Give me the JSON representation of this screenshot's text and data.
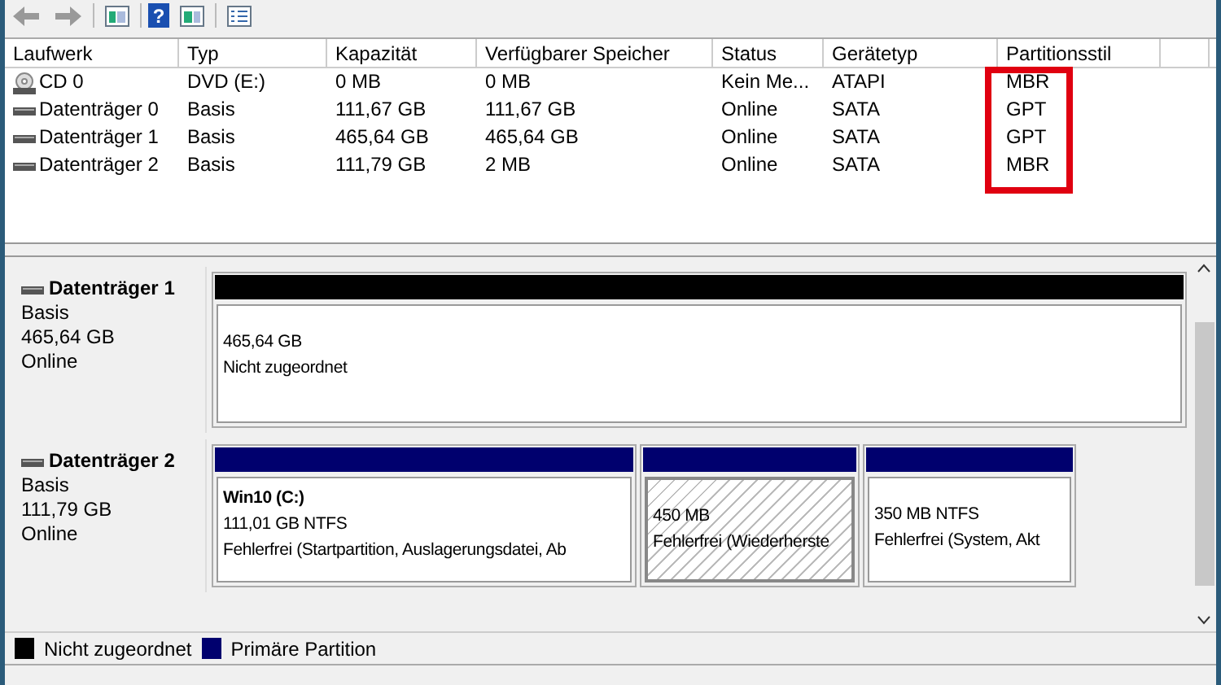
{
  "toolbar": {
    "buttons": [
      {
        "kind": "back"
      },
      {
        "kind": "forward"
      },
      {
        "kind": "panel"
      },
      {
        "kind": "help",
        "glyph": "?"
      },
      {
        "kind": "panel2"
      },
      {
        "kind": "list"
      }
    ]
  },
  "table": {
    "columns": [
      {
        "label": "Laufwerk"
      },
      {
        "label": "Typ"
      },
      {
        "label": "Kapazität"
      },
      {
        "label": "Verfügbarer Speicher"
      },
      {
        "label": "Status"
      },
      {
        "label": "Gerätetyp"
      },
      {
        "label": "Partitionsstil",
        "highlighted": true
      }
    ],
    "rows": [
      {
        "kind": "optical",
        "cells": [
          "CD 0",
          "DVD (E:)",
          "0 MB",
          "0 MB",
          "Kein Me...",
          "ATAPI",
          "MBR"
        ]
      },
      {
        "kind": "disk",
        "cells": [
          "Datenträger 0",
          "Basis",
          "111,67 GB",
          "111,67 GB",
          "Online",
          "SATA",
          "GPT"
        ]
      },
      {
        "kind": "disk",
        "cells": [
          "Datenträger 1",
          "Basis",
          "465,64 GB",
          "465,64 GB",
          "Online",
          "SATA",
          "GPT"
        ]
      },
      {
        "kind": "disk",
        "cells": [
          "Datenträger 2",
          "Basis",
          "111,79 GB",
          "2 MB",
          "Online",
          "SATA",
          "MBR"
        ]
      }
    ]
  },
  "disks": [
    {
      "name": "Datenträger 1",
      "type": "Basis",
      "size": "465,64 GB",
      "status": "Online",
      "partitions": [
        {
          "kind": "unallocated",
          "selected": false,
          "lines": [
            "465,64 GB",
            "Nicht zugeordnet"
          ]
        }
      ]
    },
    {
      "name": "Datenträger 2",
      "type": "Basis",
      "size": "111,79 GB",
      "status": "Online",
      "partitions": [
        {
          "kind": "primary",
          "selected": false,
          "title": "Win10  (C:)",
          "lines": [
            "111,01 GB NTFS",
            "Fehlerfrei (Startpartition, Auslagerungsdatei, Ab"
          ]
        },
        {
          "kind": "primary",
          "selected": true,
          "lines": [
            "450 MB",
            "Fehlerfrei (Wiederherste"
          ]
        },
        {
          "kind": "primary",
          "selected": false,
          "lines": [
            "350 MB NTFS",
            "Fehlerfrei (System, Akt"
          ]
        }
      ]
    }
  ],
  "legend": [
    {
      "label": "Nicht zugeordnet",
      "color": "#000000"
    },
    {
      "label": "Primäre Partition",
      "color": "#00006e"
    }
  ]
}
